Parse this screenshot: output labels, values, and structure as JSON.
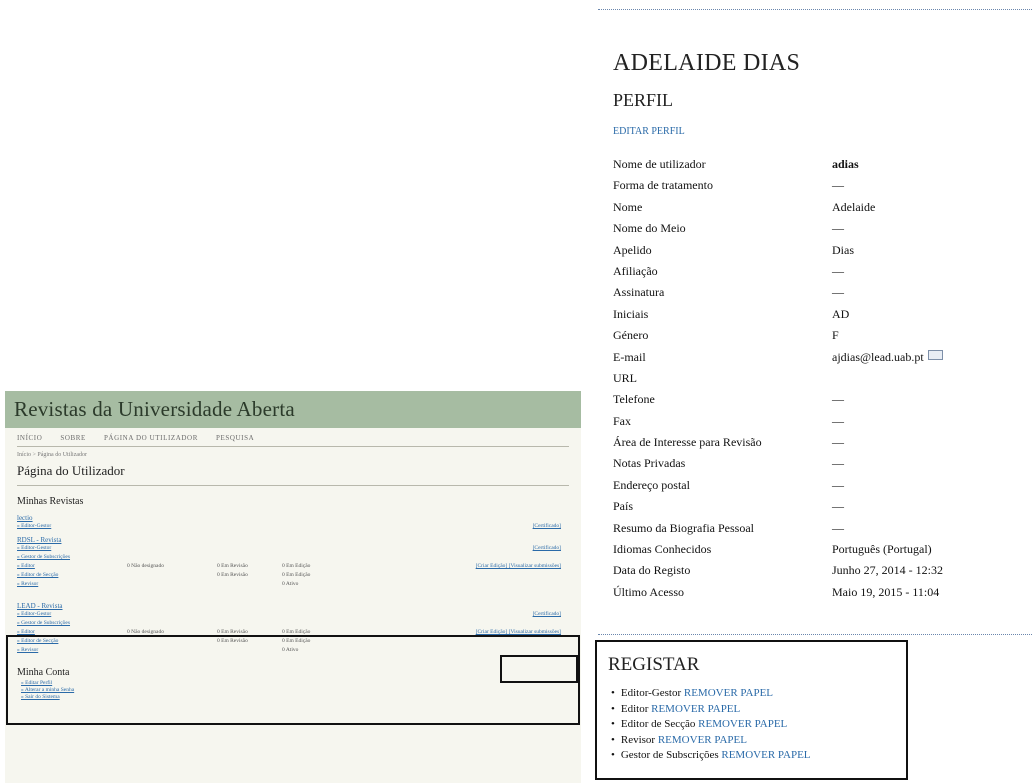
{
  "thumbnail": {
    "site_title": "Revistas da Universidade Aberta",
    "nav": [
      "Início",
      "Sobre",
      "Página do utilizador",
      "Pesquisa"
    ],
    "breadcrumb": "Início > Página do Utilizador",
    "page_title": "Página do Utilizador",
    "my_journals_title": "Minhas Revistas",
    "journals": [
      {
        "name": "lectio",
        "rows": [
          {
            "role": "» Editor-Gestor",
            "c1": "",
            "c2": "",
            "c3": "",
            "action": "[Certificado]"
          }
        ]
      },
      {
        "name": "RDSL - Revista",
        "rows": [
          {
            "role": "» Editor-Gestor",
            "c1": "",
            "c2": "",
            "c3": "",
            "action": "[Certificado]"
          },
          {
            "role": "» Gestor de Subscrições",
            "c1": "",
            "c2": "",
            "c3": "",
            "action": ""
          },
          {
            "role": "» Editor",
            "c1": "0 Não designado",
            "c2": "0 Em Revisão",
            "c3": "0 Em Edição",
            "action": "[Criar Edição] [Visualizar submissões]"
          },
          {
            "role": "» Editor de Secção",
            "c1": "",
            "c2": "0 Em Revisão",
            "c3": "0 Em Edição",
            "action": ""
          },
          {
            "role": "» Revisor",
            "c1": "",
            "c2": "",
            "c3": "0 Ativo",
            "action": ""
          }
        ]
      },
      {
        "name": "LEAD - Revista",
        "rows": [
          {
            "role": "» Editor-Gestor",
            "c1": "",
            "c2": "",
            "c3": "",
            "action": "[Certificado]"
          },
          {
            "role": "» Gestor de Subscrições",
            "c1": "",
            "c2": "",
            "c3": "",
            "action": ""
          },
          {
            "role": "» Editor",
            "c1": "0 Não designado",
            "c2": "0 Em Revisão",
            "c3": "0 Em Edição",
            "action": "[Criar Edição] [Visualizar submissões]"
          },
          {
            "role": "» Editor de Secção",
            "c1": "",
            "c2": "0 Em Revisão",
            "c3": "0 Em Edição",
            "action": ""
          },
          {
            "role": "» Revisor",
            "c1": "",
            "c2": "",
            "c3": "0 Ativo",
            "action": ""
          }
        ]
      }
    ],
    "account_title": "Minha Conta",
    "account_links": [
      "» Editar Perfil",
      "» Alterar a minha Senha",
      "» Sair do Sistema"
    ]
  },
  "profile": {
    "name": "ADELAIDE DIAS",
    "section": "PERFIL",
    "edit_link": "EDITAR PERFIL",
    "fields": [
      {
        "label": "Nome de utilizador",
        "value": "adias",
        "bold": true
      },
      {
        "label": "Forma de tratamento",
        "value": "—"
      },
      {
        "label": "Nome",
        "value": "Adelaide"
      },
      {
        "label": "Nome do Meio",
        "value": "—"
      },
      {
        "label": "Apelido",
        "value": "Dias"
      },
      {
        "label": "Afiliação",
        "value": "—"
      },
      {
        "label": "Assinatura",
        "value": "—"
      },
      {
        "label": "Iniciais",
        "value": "AD"
      },
      {
        "label": "Género",
        "value": "F"
      },
      {
        "label": "E-mail",
        "value": "ajdias@lead.uab.pt",
        "icon": "envelope-icon"
      },
      {
        "label": "URL",
        "value": ""
      },
      {
        "label": "Telefone",
        "value": "—"
      },
      {
        "label": "Fax",
        "value": "—"
      },
      {
        "label": "Área de Interesse para Revisão",
        "value": "—"
      },
      {
        "label": "Notas Privadas",
        "value": "—"
      },
      {
        "label": "Endereço postal",
        "value": "—"
      },
      {
        "label": "País",
        "value": "—"
      },
      {
        "label": "Resumo da Biografia Pessoal",
        "value": "—"
      },
      {
        "label": "Idiomas Conhecidos",
        "value": "Português (Portugal)"
      },
      {
        "label": "Data do Registo",
        "value": "Junho 27, 2014 - 12:32"
      },
      {
        "label": "Último Acesso",
        "value": "Maio 19, 2015 - 11:04"
      }
    ]
  },
  "registar": {
    "title": "REGISTAR",
    "roles": [
      {
        "role": "Editor-Gestor",
        "action": "REMOVER PAPEL"
      },
      {
        "role": "Editor",
        "action": "REMOVER PAPEL"
      },
      {
        "role": "Editor de Secção",
        "action": "REMOVER PAPEL"
      },
      {
        "role": "Revisor",
        "action": "REMOVER PAPEL"
      },
      {
        "role": "Gestor de Subscrições",
        "action": "REMOVER PAPEL"
      }
    ]
  },
  "colors": {
    "header_green": "#a6bca2",
    "link_blue": "#2a6aa8",
    "dotted_rule": "#6a86ad"
  }
}
